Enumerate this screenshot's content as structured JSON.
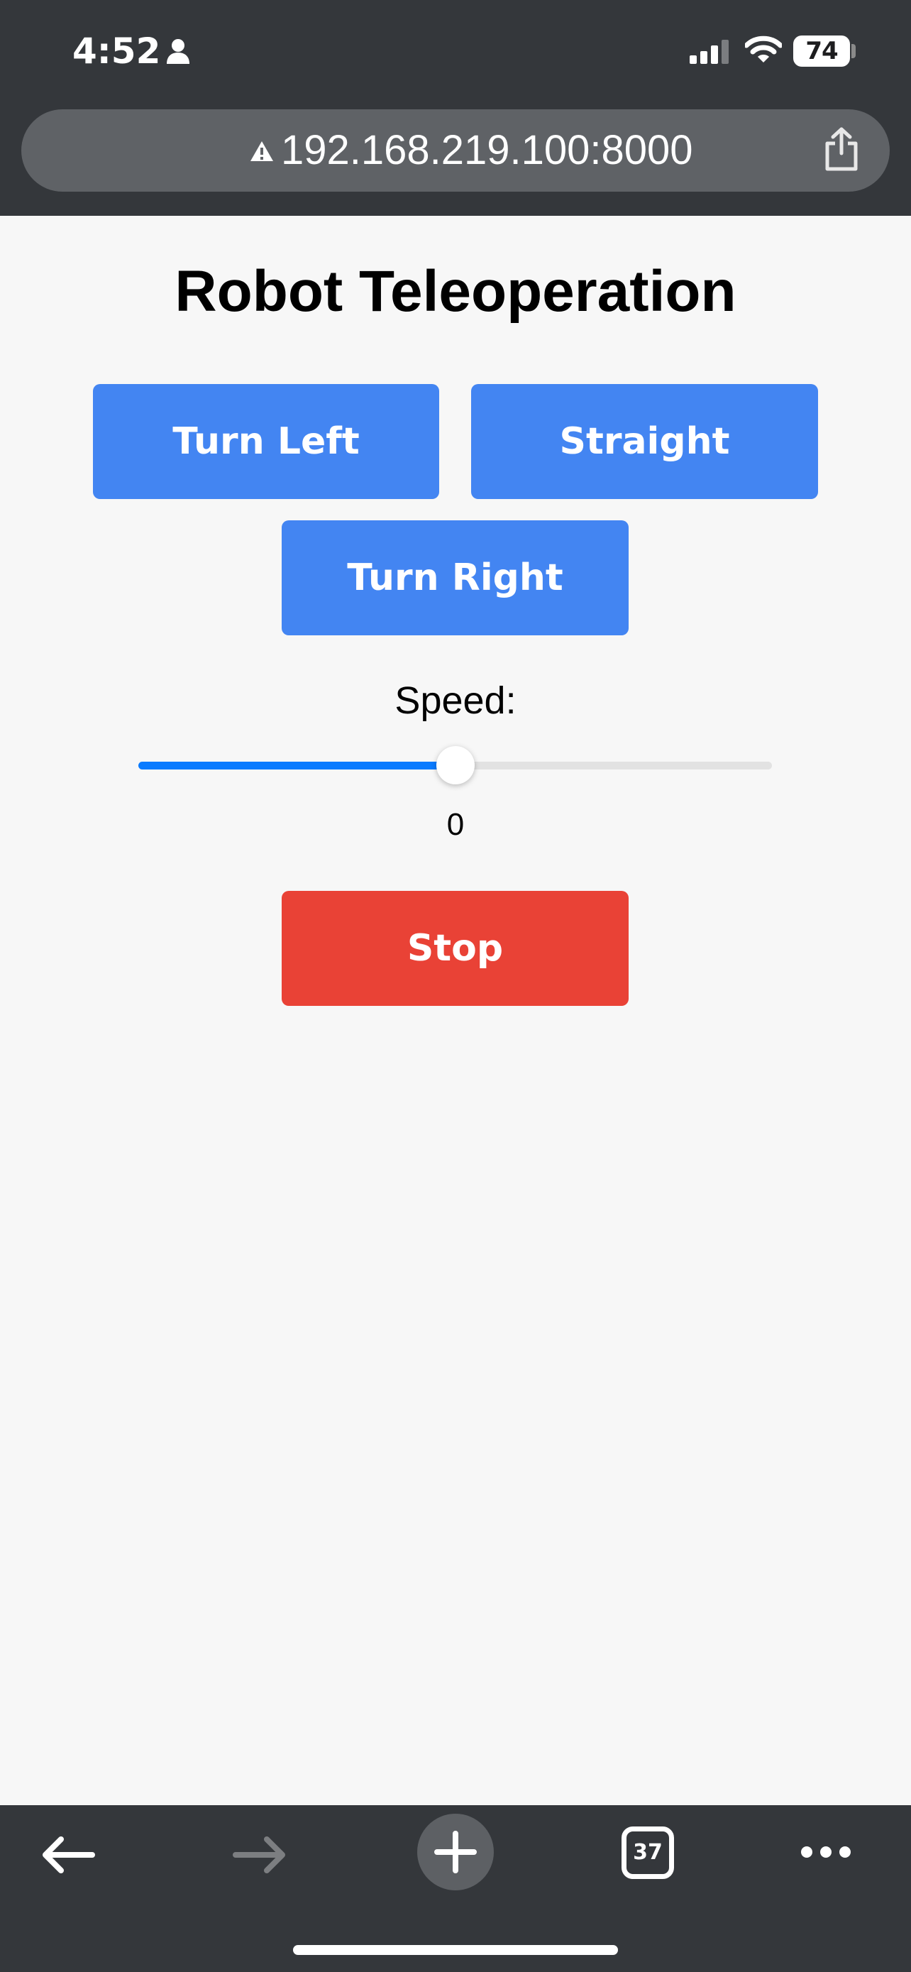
{
  "status_bar": {
    "time": "4:52",
    "battery": "74",
    "icons": [
      "person-icon",
      "cellular-signal-icon",
      "wifi-icon",
      "battery-icon"
    ]
  },
  "browser": {
    "url": "192.168.219.100:8000",
    "url_icon": "warning-icon",
    "share_icon": "share-icon",
    "toolbar": {
      "back_icon": "back-arrow-icon",
      "forward_icon": "forward-arrow-icon",
      "new_tab_icon": "plus-icon",
      "tab_count": "37",
      "more_icon": "more-icon"
    }
  },
  "page": {
    "title": "Robot Teleoperation",
    "buttons": {
      "turn_left": "Turn Left",
      "straight": "Straight",
      "turn_right": "Turn Right",
      "stop": "Stop"
    },
    "speed": {
      "label": "Speed:",
      "value": "0",
      "slider_fraction": 0.5
    }
  },
  "colors": {
    "browser_chrome": "#34373b",
    "url_bar": "#5f6266",
    "page_background": "#f7f7f7",
    "button_blue": "#4385f2",
    "button_red": "#e94236",
    "slider_fill": "#0a7bff",
    "slider_track": "#e2e2e2"
  }
}
